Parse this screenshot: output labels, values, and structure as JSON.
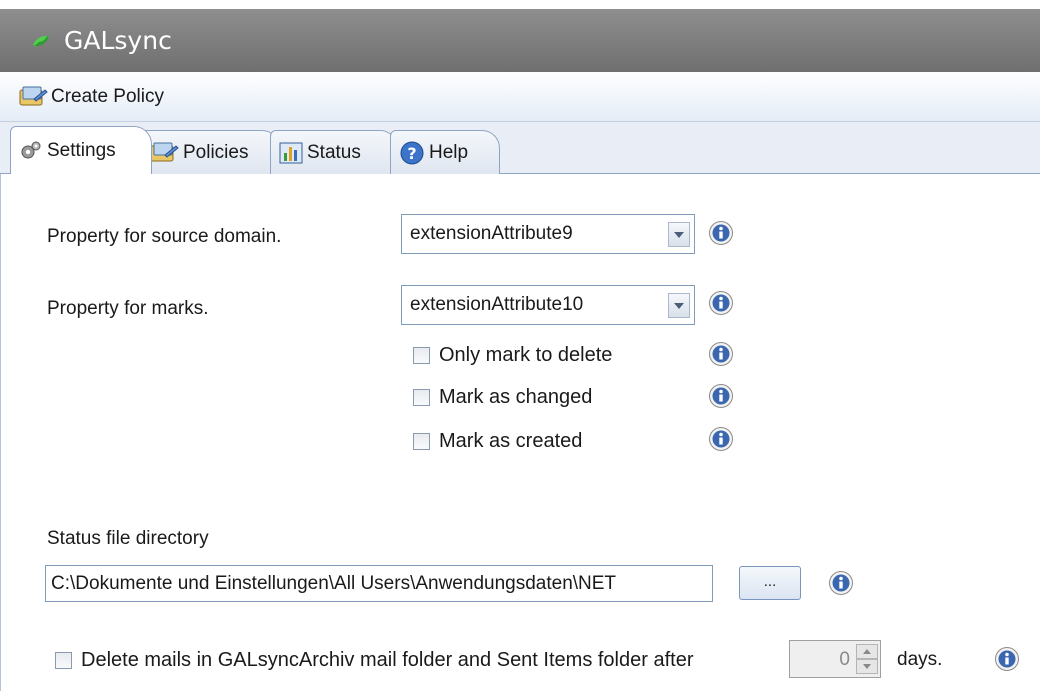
{
  "window": {
    "title": "GALsync"
  },
  "toolbar": {
    "create_policy": "Create Policy"
  },
  "tabs": [
    {
      "label": "Settings",
      "icon": "gears-icon",
      "active": true
    },
    {
      "label": "Policies",
      "icon": "policy-icon",
      "active": false
    },
    {
      "label": "Status",
      "icon": "bar-chart-icon",
      "active": false
    },
    {
      "label": "Help",
      "icon": "help-icon",
      "active": false
    }
  ],
  "settings": {
    "source_domain": {
      "label": "Property for source domain.",
      "value": "extensionAttribute9"
    },
    "marks": {
      "label": "Property for marks.",
      "value": "extensionAttribute10"
    },
    "checkboxes": {
      "only_mark_delete": {
        "label": "Only mark to delete",
        "checked": false
      },
      "mark_changed": {
        "label": "Mark as changed",
        "checked": false
      },
      "mark_created": {
        "label": "Mark as created",
        "checked": false
      }
    },
    "status_dir": {
      "label": "Status file directory",
      "value": "C:\\Dokumente und Einstellungen\\All Users\\Anwendungsdaten\\NET",
      "browse_label": "..."
    },
    "delete_mails": {
      "label": "Delete mails in GALsyncArchiv mail folder and Sent Items folder after",
      "checked": false,
      "days_value": "0",
      "days_label": "days."
    }
  },
  "colors": {
    "titlebar": "#7f7f7f",
    "info_icon": "#2f5fa8",
    "tab_border": "#8fa4c4"
  }
}
